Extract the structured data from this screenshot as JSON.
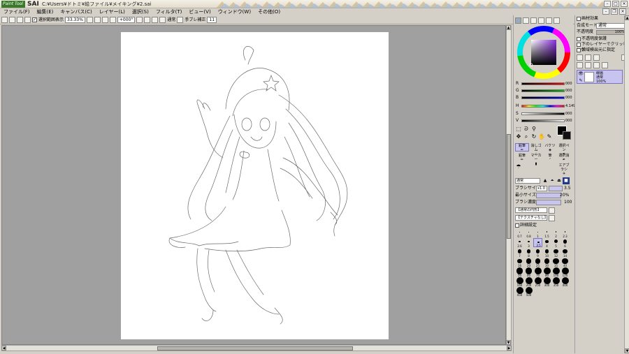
{
  "titlebar": {
    "logo": "Paint Tool",
    "app_name": "SAI",
    "file_path": "C:¥Users¥ドトミ¥絵ファイル¥メイキング¥2.sai"
  },
  "menu": [
    "ファイル(F)",
    "編集(E)",
    "キャンバス(C)",
    "レイヤー(L)",
    "選択(S)",
    "フィルタ(T)",
    "ビュー(V)",
    "ウィンドウ(W)",
    "その他(O)"
  ],
  "toolbar": {
    "show_selection_label": "選択範囲表示",
    "zoom": "33.33%",
    "rotation": "+000°",
    "blend": "通常",
    "stabilizer_label": "手ブレ補正",
    "stabilizer_value": "11"
  },
  "color_sliders": [
    {
      "label": "R",
      "value": "000",
      "color": "#ff0000"
    },
    {
      "label": "G",
      "value": "000",
      "color": "#00b000"
    },
    {
      "label": "B",
      "value": "000",
      "color": "#0000ff"
    },
    {
      "label": "H",
      "value": "4.149",
      "color": "hue"
    },
    {
      "label": "S",
      "value": "000",
      "color": "#000000"
    },
    {
      "label": "V",
      "value": "000",
      "color": "#000000"
    }
  ],
  "tools": {
    "row1": [
      "鉛筆",
      "消しゴム",
      "バケツ",
      "選択ペン"
    ],
    "row2": [
      "",
      "",
      "",
      "選択消"
    ],
    "row3": [
      "鉛筆",
      "マーカー",
      "筆",
      "エアブラシ"
    ]
  },
  "brush": {
    "mode": "通常",
    "size_label": "ブラシサイズ",
    "size_mult": "x1.0",
    "size_value": "3.5",
    "min_size_label": "最小サイズ",
    "min_size_value": "20%",
    "density_label": "ブラシ濃度",
    "density_value": "100",
    "edge": "【通常の円形】",
    "texture": "【テクスチャなし】",
    "detail": "詳細設定"
  },
  "brush_sizes": [
    "0.7",
    "0.8",
    "1",
    "1.5",
    "2",
    "2.3",
    "2.6",
    "3",
    "3.5",
    "4",
    "5",
    "6",
    "7",
    "8",
    "9",
    "10",
    "12",
    "14",
    "16",
    "20",
    "25",
    "30",
    "35",
    "40",
    "50",
    "60",
    "70",
    "80",
    "100",
    "120",
    "160",
    "200",
    "250",
    "300",
    "350",
    "400",
    "450",
    "500"
  ],
  "layer_panel": {
    "header": "画材効果",
    "blend_label": "合成モード",
    "blend_value": "通常",
    "opacity_label": "不透明度",
    "opacity_value": "100%",
    "protect_alpha": "不透明度保護",
    "clip": "下のレイヤーでクリッピング",
    "source": "領域検出元に指定",
    "layer_name": "線画",
    "layer_mode": "通常",
    "layer_opacity": "100%"
  }
}
